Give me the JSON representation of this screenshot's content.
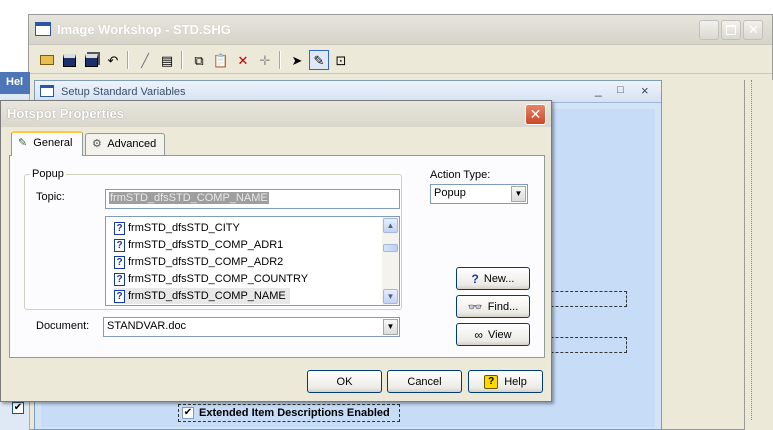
{
  "background_window": {
    "title": "Image Workshop - STD.SHG",
    "toolbar_icons": [
      "open-folder-icon",
      "save-icon",
      "save-all-icon",
      "undo-icon",
      "line-icon",
      "properties-icon",
      "copy-icon",
      "paste-icon",
      "delete-icon",
      "move-icon",
      "pointer-icon",
      "hotspot-edit-icon",
      "select-region-icon"
    ]
  },
  "setup_window": {
    "title": "Setup Standard Variables",
    "controls": [
      "_",
      "□",
      "×"
    ],
    "extended_item_label": "Extended Item Descriptions Enabled"
  },
  "left_strip": {
    "title": "Hel"
  },
  "dialog": {
    "title": "Hotspot Properties",
    "close_glyph": "✕",
    "tabs": [
      {
        "label": "General",
        "active": true
      },
      {
        "label": "Advanced",
        "active": false
      }
    ],
    "popup_group_label": "Popup",
    "topic_label": "Topic:",
    "topic_value": "frmSTD_dfsSTD_COMP_NAME",
    "topic_list": [
      "frmSTD_dfsSTD_CITY",
      "frmSTD_dfsSTD_COMP_ADR1",
      "frmSTD_dfsSTD_COMP_ADR2",
      "frmSTD_dfsSTD_COMP_COUNTRY",
      "frmSTD_dfsSTD_COMP_NAME"
    ],
    "selected_topic_index": 4,
    "document_label": "Document:",
    "document_value": "STANDVAR.doc",
    "action_type_label": "Action Type:",
    "action_type_value": "Popup",
    "buttons": {
      "new": "New...",
      "find": "Find...",
      "view": "View",
      "ok": "OK",
      "cancel": "Cancel",
      "help": "Help"
    }
  },
  "colors": {
    "dialog_face": "#ece9d8",
    "panel_face": "#fcfcfe",
    "active_tab_highlight": "#ffc83c",
    "close_button": "#c8472a",
    "setup_background": "#c6dcf7",
    "input_border": "#7f9db9"
  }
}
